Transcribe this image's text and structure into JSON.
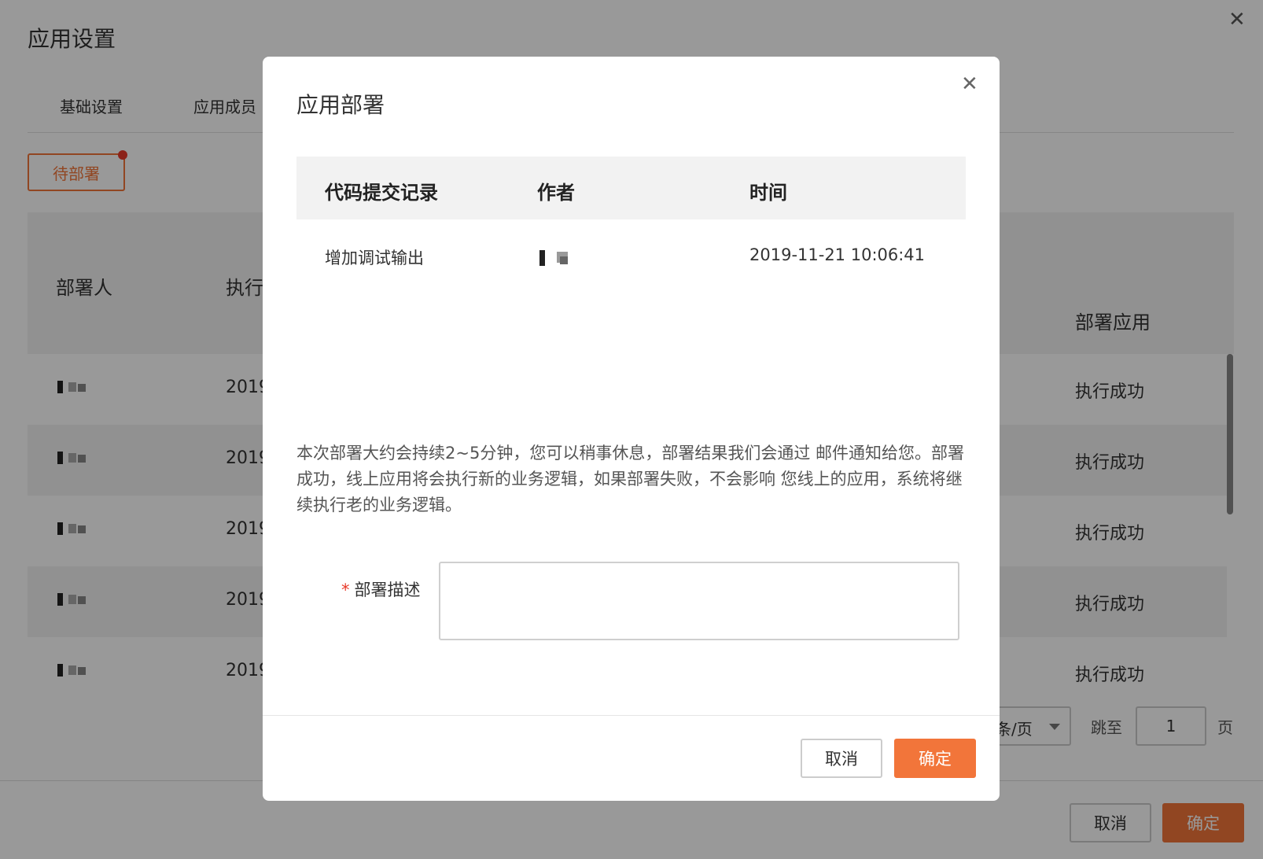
{
  "page": {
    "title": "应用设置",
    "close_icon": "close-icon",
    "tabs": [
      "基础设置",
      "应用成员"
    ],
    "pending_button": "待部署",
    "table": {
      "headers": [
        "部署人",
        "执行",
        "部署应用"
      ],
      "rows": [
        {
          "date": "2019",
          "status": "执行成功"
        },
        {
          "date": "2019",
          "status": "执行成功"
        },
        {
          "date": "2019",
          "status": "执行成功"
        },
        {
          "date": "2019",
          "status": "执行成功"
        },
        {
          "date": "2019",
          "status": "执行成功"
        }
      ]
    },
    "pagination": {
      "page_size_label": "条/页",
      "jump_label": "跳至",
      "jump_value": "1",
      "page_unit": "页"
    },
    "footer": {
      "cancel": "取消",
      "confirm": "确定"
    }
  },
  "modal": {
    "title": "应用部署",
    "close_icon": "close-icon",
    "table": {
      "headers": [
        "代码提交记录",
        "作者",
        "时间"
      ],
      "rows": [
        {
          "commit": "增加调试输出",
          "time": "2019-11-21 10:06:41"
        }
      ]
    },
    "notice": "本次部署大约会持续2~5分钟，您可以稍事休息，部署结果我们会通过 邮件通知给您。部署成功，线上应用将会执行新的业务逻辑，如果部署失败，不会影响 您线上的应用，系统将继续执行老的业务逻辑。",
    "form": {
      "required_mark": "*",
      "label": "部署描述",
      "value": ""
    },
    "buttons": {
      "cancel": "取消",
      "confirm": "确定"
    }
  },
  "colors": {
    "accent": "#f2753a",
    "required": "#e83a2a",
    "overlay": "rgba(0,0,0,0.4)"
  }
}
